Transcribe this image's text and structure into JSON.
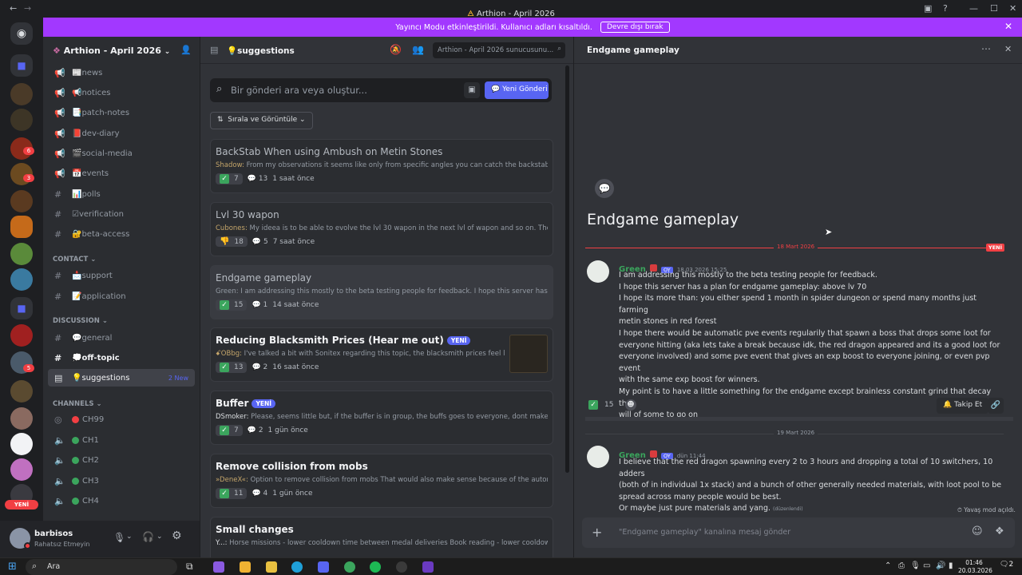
{
  "window": {
    "title": "Arthion - April 2026"
  },
  "banner": {
    "text": "Yayıncı Modu etkinleştirildi. Kullanıcı adları kısaltıldı.",
    "button": "Devre dışı bırak"
  },
  "sidebar": {
    "server_name": "Arthion - April 2026",
    "channels_top": [
      {
        "icon": "megaphone-icon",
        "label": "📰news"
      },
      {
        "icon": "megaphone-icon",
        "label": "📢notices"
      },
      {
        "icon": "megaphone-icon",
        "label": "📑patch-notes"
      },
      {
        "icon": "megaphone-icon",
        "label": "📕dev-diary"
      },
      {
        "icon": "megaphone-icon",
        "label": "🎬social-media"
      },
      {
        "icon": "megaphone-icon",
        "label": "📅events"
      },
      {
        "icon": "hash-icon",
        "label": "📊polls"
      },
      {
        "icon": "hash-icon",
        "label": "☑verification"
      },
      {
        "icon": "hash-icon",
        "label": "🔐beta-access"
      }
    ],
    "cat_contact": "CONTACT",
    "channels_contact": [
      "📩support",
      "📝application"
    ],
    "cat_discussion": "DISCUSSION",
    "channels_discussion": [
      "💬general",
      "💭off-topic",
      "💡suggestions"
    ],
    "suggestions_new": "2 New",
    "cat_channels": "CHANNELS",
    "voice": [
      "CH99",
      "CH1",
      "CH2",
      "CH3",
      "CH4"
    ],
    "yeni": "YENİ"
  },
  "user": {
    "name": "barbisos",
    "status": "Rahatsız Etmeyin"
  },
  "forum": {
    "channel": "💡suggestions",
    "server_search": "Arthion - April 2026 sunucusunu...",
    "search_placeholder": "Bir gönderi ara veya oluştur...",
    "new_post": "Yeni Gönderi",
    "sort": "Sırala ve Görüntüle",
    "yeni": "YENİ",
    "posts": [
      {
        "title": "BackStab When using Ambush on Metin Stones",
        "author": "Shadow:",
        "preview": " From my observations it seems like only from specific angles you can catch the backstab whe...",
        "reactions": "7",
        "replies": "13",
        "time": "1 saat önce"
      },
      {
        "title": "Lvl 30 wapon",
        "author": "Cubones:",
        "preview": " My ideea is to be able to evolve the lvl 30 wapon in the next lvl of wapon and so on. The bonu...",
        "reactions": "18",
        "replies": "5",
        "time": "7 saat önce"
      },
      {
        "title": "Endgame gameplay",
        "author": "Green:",
        "preview": " I am addressing this mostly to the beta testing people for feedback. I hope this server has a pla...",
        "reactions": "15",
        "replies": "1",
        "time": "14 saat önce"
      },
      {
        "title": "Reducing Blacksmith Prices (Hear me out)",
        "author": "ꗃOBbg:",
        "preview": " I've talked a bit with Sonitex regarding this topic, the blacksmith prices feel like ...",
        "reactions": "13",
        "replies": "2",
        "time": "16 saat önce"
      },
      {
        "title": "Buffer",
        "author": "DSmoker:",
        "preview": " Please, seems little but, if the buffer is in group, the buffs goes to everyone, dont make it lik...",
        "reactions": "7",
        "replies": "2",
        "time": "1 gün önce"
      },
      {
        "title": "Remove collision from mobs",
        "author": "»DeneX«:",
        "preview": " Option to remove collision from mobs That would also make sense because of the automati...",
        "reactions": "11",
        "replies": "4",
        "time": "1 gün önce"
      },
      {
        "title": "Small changes",
        "author": "Y...:",
        "preview": " Horse missions - lower cooldown time between medal deliveries Book reading - lower cooldown t..."
      }
    ]
  },
  "thread": {
    "header": "Endgame gameplay",
    "title": "Endgame gameplay",
    "date1": "18 Mart 2026",
    "new_tag": "YENİ",
    "msg1": {
      "author": "Green",
      "role": "OY",
      "time": "18.03.2026 15:25",
      "lines": [
        "I am addressing this mostly to the beta testing people for feedback.",
        "I hope this server has a plan for endgame gameplay: above lv 70",
        "I hope its more than: you either spend 1 month in spider dungeon or spend many months just farming",
        "metin stones in red forest",
        "I hope there would be automatic pve events regularily that spawn a boss that drops some loot for",
        "everyone hitting (aka lets take a break because idk, the red dragon appeared and its a good loot for",
        "everyone involved) and some pve event that gives an exp boost to everyone joining, or even pvp event",
        "with the same exp boost for winners.",
        "My point is to have a little something for the endgame except brainless constant grind that decay the",
        "will of some to go on"
      ]
    },
    "reaction_count": "15",
    "follow": "Takip Et",
    "date2": "19 Mart 2026",
    "msg2": {
      "author": "Green",
      "role": "OY",
      "time": "dün 11:44",
      "lines": [
        "I believe that the red dragon spawning every 2 to 3 hours and dropping a total of 10 switchers, 10 adders",
        "(both of in  individual  1x stack) and a bunch of other generally needed materials, with loot pool to be",
        "spread across many people would be best.",
        "Or maybe just pure materials and yang."
      ],
      "edited": "(düzenlendi)"
    },
    "slowmode": "Yavaş mod açıldı.",
    "composer_placeholder": "\"Endgame gameplay\" kanalına mesaj gönder"
  },
  "taskbar": {
    "search": "Ara",
    "time": "01:46",
    "date": "20.03.2026",
    "notif": "2"
  }
}
